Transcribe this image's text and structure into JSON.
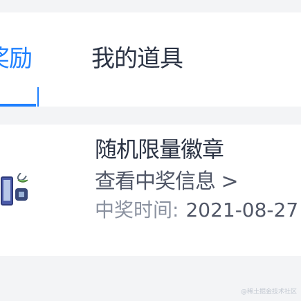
{
  "tabs": {
    "left_label": "奖励",
    "right_label": "我的道具"
  },
  "prize": {
    "title": "随机限量徽章",
    "view_link": "查看中奖信息",
    "view_arrow": ">",
    "win_time_label": "中奖时间:",
    "win_time_value": "2021-08-27"
  },
  "watermark": "@稀土掘金技术社区",
  "colors": {
    "accent": "#1e80ff",
    "text_primary": "#2b3344",
    "text_secondary": "#515767",
    "background": "#f3f4f6"
  }
}
